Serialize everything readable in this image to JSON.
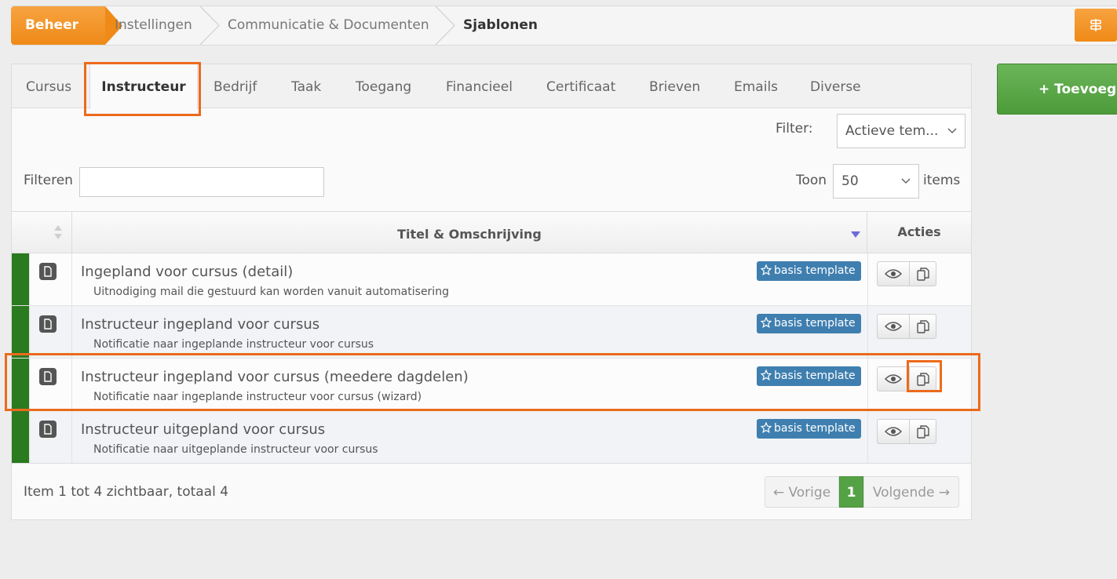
{
  "breadcrumb": {
    "items": [
      "Beheer",
      "Instellingen",
      "Communicatie & Documenten",
      "Sjablonen"
    ]
  },
  "menu_icon": "menu-icon",
  "add_button": {
    "label": "+ Toevoegen"
  },
  "tabs": [
    "Cursus",
    "Instructeur",
    "Bedrijf",
    "Taak",
    "Toegang",
    "Financieel",
    "Certificaat",
    "Brieven",
    "Emails",
    "Diverse"
  ],
  "active_tab": "Instructeur",
  "filter": {
    "label": "Filter:",
    "selected": "Actieve tem..."
  },
  "search": {
    "label": "Filteren",
    "value": ""
  },
  "page_size": {
    "label": "Toon",
    "selected": "50",
    "suffix": "items"
  },
  "table": {
    "headers": {
      "title": "Titel & Omschrijving",
      "actions": "Acties"
    },
    "rows": [
      {
        "title": "Ingepland voor cursus (detail)",
        "desc": "Uitnodiging mail die gestuurd kan worden vanuit automatisering",
        "badge": "basis template"
      },
      {
        "title": "Instructeur ingepland voor cursus",
        "desc": "Notificatie naar ingeplande instructeur voor cursus",
        "badge": "basis template"
      },
      {
        "title": "Instructeur ingepland voor cursus (meedere dagdelen)",
        "desc": "Notificatie naar ingeplande instructeur voor cursus (wizard)",
        "badge": "basis template"
      },
      {
        "title": "Instructeur uitgepland voor cursus",
        "desc": "Notificatie naar uitgeplande instructeur voor cursus",
        "badge": "basis template"
      }
    ]
  },
  "footer": {
    "summary": "Item 1 tot 4 zichtbaar, totaal 4",
    "prev": "← Vorige",
    "current_page": "1",
    "next": "Volgende →"
  },
  "colors": {
    "accent_orange": "#ef8a17",
    "add_green": "#4c9b3a",
    "row_bar_green": "#2a7a1f",
    "badge_blue": "#3f7fb0",
    "highlight": "#ec6a1c"
  }
}
